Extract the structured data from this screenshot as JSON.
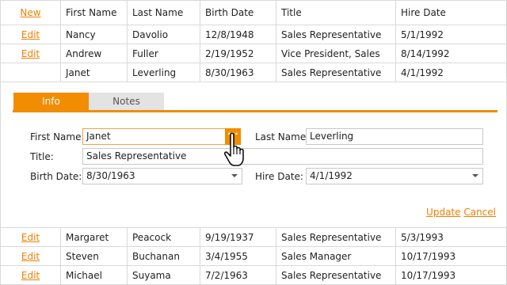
{
  "grid": {
    "columns": [
      "New",
      "First Name",
      "Last Name",
      "Birth Date",
      "Title",
      "Hire Date"
    ],
    "rows_top": [
      {
        "cmd": "Edit",
        "first": "Nancy",
        "last": "Davolio",
        "birth": "12/8/1948",
        "title": "Sales Representative",
        "hire": "5/1/1992"
      },
      {
        "cmd": "Edit",
        "first": "Andrew",
        "last": "Fuller",
        "birth": "2/19/1952",
        "title": "Vice President, Sales",
        "hire": "8/14/1992"
      },
      {
        "cmd": "",
        "first": "Janet",
        "last": "Leverling",
        "birth": "8/30/1963",
        "title": "Sales Representative",
        "hire": "4/1/1992"
      }
    ],
    "rows_bottom": [
      {
        "cmd": "Edit",
        "first": "Margaret",
        "last": "Peacock",
        "birth": "9/19/1937",
        "title": "Sales Representative",
        "hire": "5/3/1993"
      },
      {
        "cmd": "Edit",
        "first": "Steven",
        "last": "Buchanan",
        "birth": "3/4/1955",
        "title": "Sales Manager",
        "hire": "10/17/1993"
      },
      {
        "cmd": "Edit",
        "first": "Michael",
        "last": "Suyama",
        "birth": "7/2/1963",
        "title": "Sales Representative",
        "hire": "10/17/1993"
      }
    ]
  },
  "editform": {
    "tabs": [
      "Info",
      "Notes"
    ],
    "labels": {
      "first_name": "First Name:",
      "last_name": "Last Name:",
      "title": "Title:",
      "birth_date": "Birth Date:",
      "hire_date": "Hire Date:"
    },
    "values": {
      "first_name": "Janet",
      "last_name": "Leverling",
      "title": "Sales Representative",
      "birth_date": "8/30/1963",
      "hire_date": "4/1/1992"
    },
    "ellipsis_label": "···",
    "update_label": "Update",
    "cancel_label": "Cancel"
  },
  "colors": {
    "accent": "#f28c00",
    "link": "#f08000"
  },
  "icons": {
    "cursor": "hand-pointer-icon",
    "dropdown": "chevron-down-icon"
  }
}
